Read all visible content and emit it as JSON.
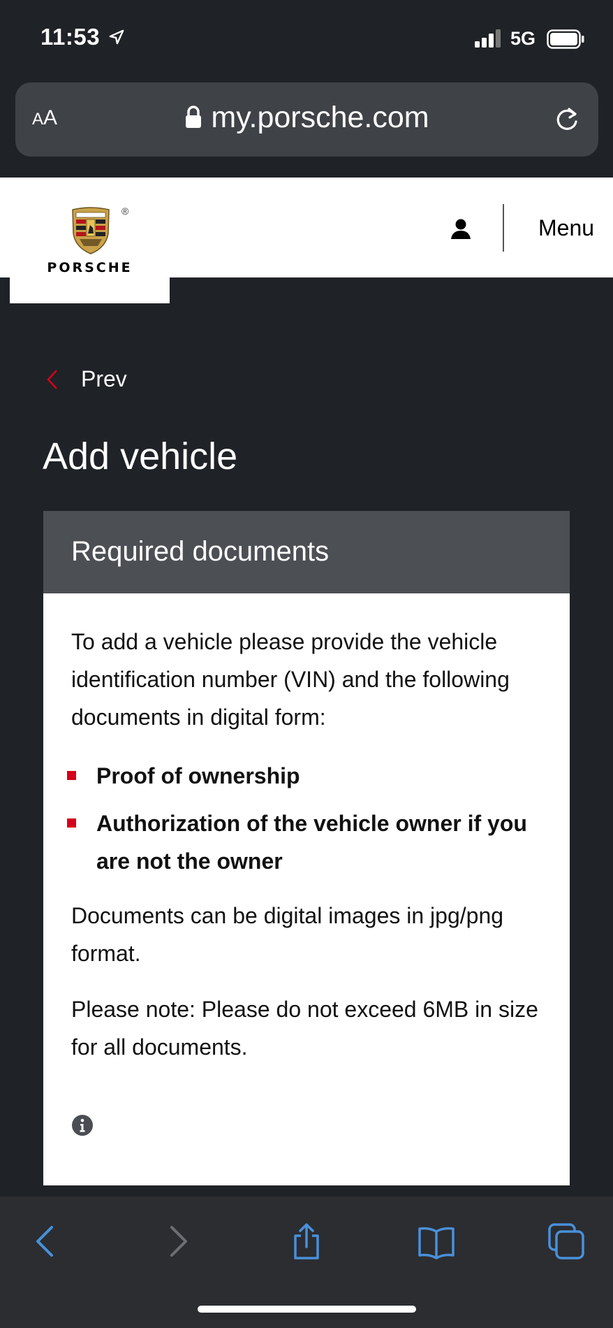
{
  "status_bar": {
    "time": "11:53",
    "network": "5G"
  },
  "browser": {
    "text_size_label_small": "A",
    "text_size_label_large": "A",
    "url": "my.porsche.com"
  },
  "header": {
    "wordmark": "PORSCHE",
    "registered": "®",
    "menu_label": "Menu"
  },
  "page": {
    "prev_label": "Prev",
    "title": "Add vehicle"
  },
  "card": {
    "title": "Required documents",
    "intro": "To add a vehicle please provide the vehicle identification number (VIN) and the following documents in digital form:",
    "documents": [
      "Proof of ownership",
      "Authorization of the vehicle owner if you are not the owner"
    ],
    "format_note": "Documents can be digital images in jpg/png format.",
    "size_note": "Please note: Please do not exceed 6MB in size for all documents."
  },
  "colors": {
    "accent": "#d5001c",
    "page_bg": "#1f2226",
    "card_header_bg": "#4c4f54",
    "toolbar_icon": "#4a90d9"
  },
  "icons": {
    "location": "location-arrow-icon",
    "signal": "cellular-signal-icon",
    "battery": "battery-icon",
    "lock": "lock-icon",
    "reload": "reload-icon",
    "user": "user-icon",
    "prev": "chevron-left-icon",
    "info": "info-icon",
    "back": "back-arrow-icon",
    "forward": "forward-arrow-icon",
    "share": "share-icon",
    "bookmarks": "bookmarks-icon",
    "tabs": "tabs-icon"
  }
}
